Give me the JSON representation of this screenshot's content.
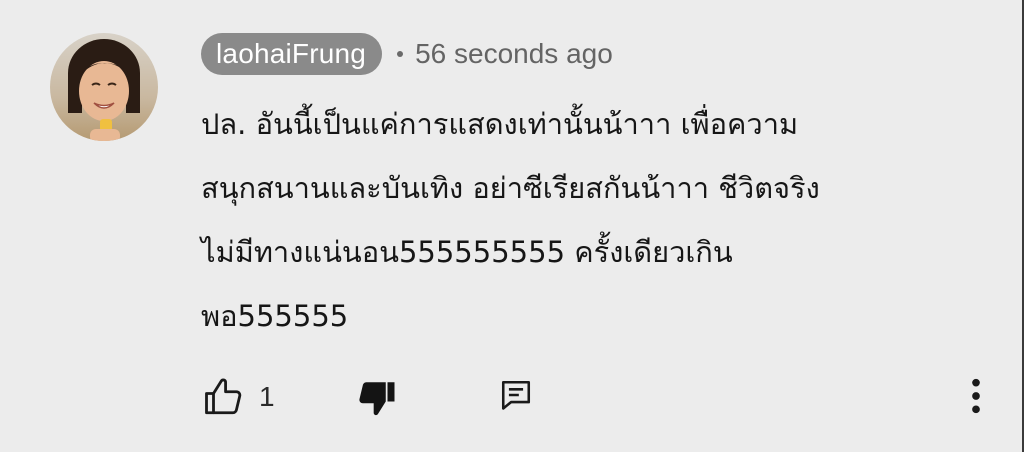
{
  "comment": {
    "author": "laohaiFrung",
    "separator": "•",
    "timestamp": "56 seconds ago",
    "text_lines": [
      "ปล. อันนี้เป็นแค่การแสดงเท่านั้นน้าาา เพื่อความ",
      "สนุกสนานและบันเทิง อย่าซีเรียสกันน้าาา ชีวิตจริง",
      "ไม่มีทางแน่นอน555555555 ครั้งเดียวเกิน",
      "พอ555555"
    ],
    "like_count": "1"
  },
  "icons": {
    "avatar": "avatar-photo",
    "like": "thumbs-up-icon",
    "dislike": "thumbs-down-icon",
    "reply": "reply-comment-icon",
    "more": "more-vertical-icon"
  },
  "colors": {
    "background": "#ececec",
    "author_chip": "#8a8a8a",
    "text": "#161616",
    "meta_text": "#646464"
  }
}
